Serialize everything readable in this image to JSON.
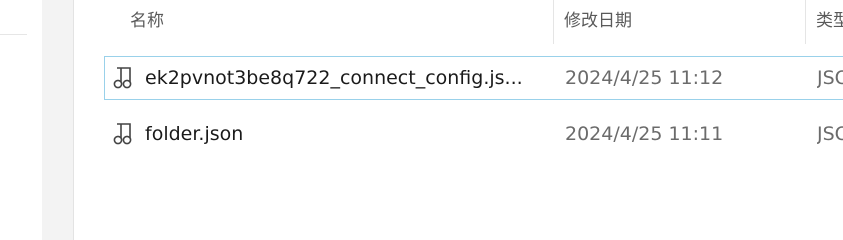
{
  "header": {
    "name_label": "名称",
    "date_label": "修改日期",
    "type_label": "类型"
  },
  "files": [
    {
      "name": "ek2pvnot3be8q722_connect_config.js...",
      "modified": "2024/4/25 11:12",
      "type": "JSO",
      "icon": "json-file-icon",
      "selected": true
    },
    {
      "name": "folder.json",
      "modified": "2024/4/25 11:11",
      "type": "JSO",
      "icon": "json-file-icon",
      "selected": false
    }
  ],
  "colors": {
    "selection_border": "#99d1ea",
    "header_text": "#5a5a5a",
    "date_text": "#6b6b6b"
  }
}
